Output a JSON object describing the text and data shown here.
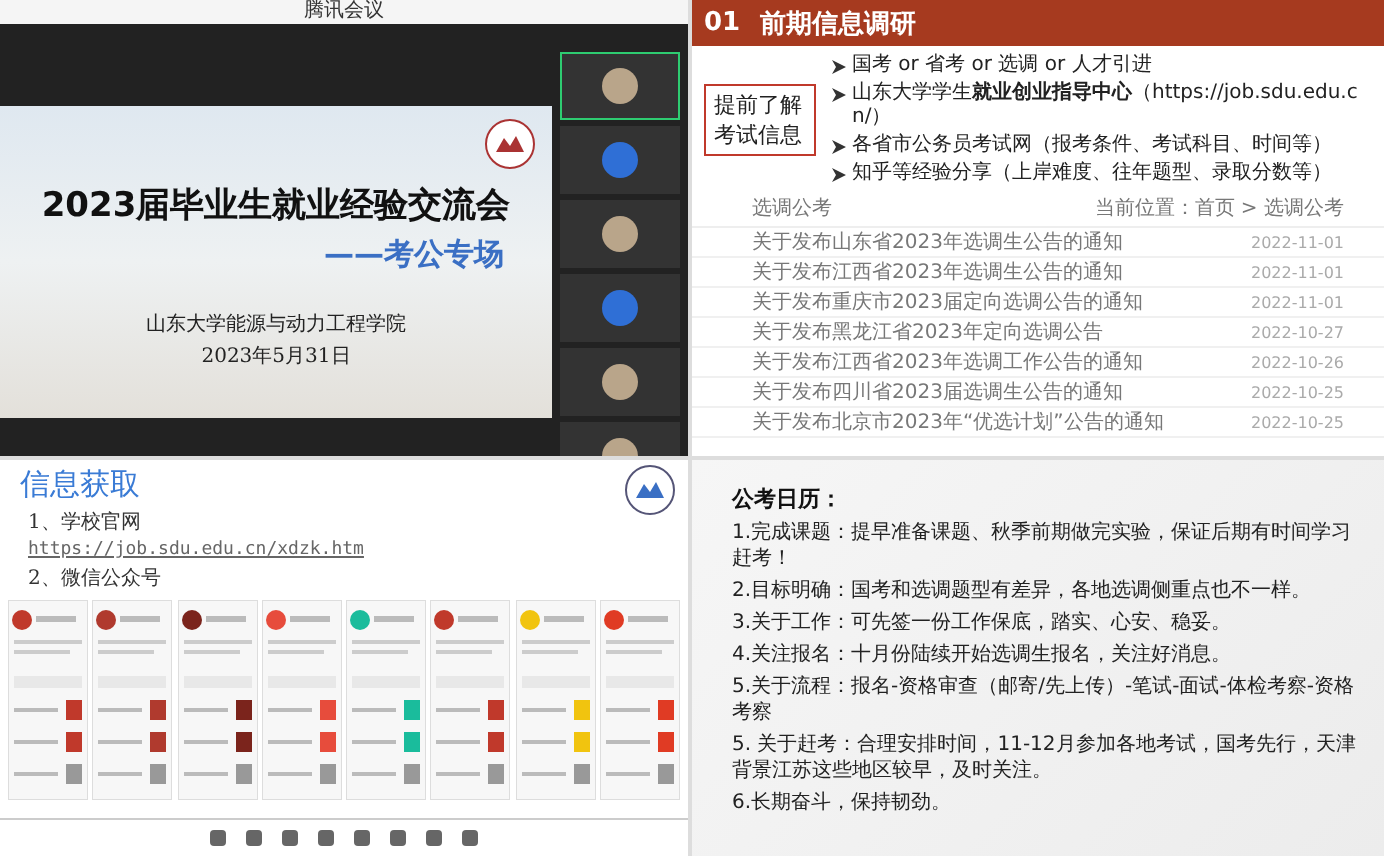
{
  "meeting": {
    "title": "腾讯会议",
    "slide": {
      "title": "2023届毕业生就业经验交流会",
      "subtitle": "——考公专场",
      "school": "山东大学能源与动力工程学院",
      "date": "2023年5月31日"
    },
    "participants": [
      {
        "kind": "photo",
        "speaking": true
      },
      {
        "kind": "initials",
        "speaking": false
      },
      {
        "kind": "photo",
        "speaking": false
      },
      {
        "kind": "initials",
        "speaking": false
      },
      {
        "kind": "photo",
        "speaking": false
      },
      {
        "kind": "photo",
        "speaking": false
      }
    ]
  },
  "research": {
    "number": "01",
    "heading": "前期信息调研",
    "callout": "提前了解考试信息",
    "bullets": [
      "国考 or 省考 or 选调 or 人才引进",
      "山东大学学生**就业创业指导中心**（https://job.sdu.edu.cn/）",
      "各省市公务员考试网（报考条件、考试科目、时间等）",
      "知乎等经验分享（上岸难度、往年题型、录取分数等）"
    ],
    "list_title": "选调公考",
    "breadcrumb": "当前位置：首页 > 选调公考",
    "rows": [
      {
        "title": "关于发布山东省2023年选调生公告的通知",
        "date": "2022-11-01"
      },
      {
        "title": "关于发布江西省2023年选调生公告的通知",
        "date": "2022-11-01"
      },
      {
        "title": "关于发布重庆市2023届定向选调公告的通知",
        "date": "2022-11-01"
      },
      {
        "title": "关于发布黑龙江省2023年定向选调公告",
        "date": "2022-10-27"
      },
      {
        "title": "关于发布江西省2023年选调工作公告的通知",
        "date": "2022-10-26"
      },
      {
        "title": "关于发布四川省2023届选调生公告的通知",
        "date": "2022-10-25"
      },
      {
        "title": "关于发布北京市2023年“优选计划”公告的通知",
        "date": "2022-10-25"
      }
    ]
  },
  "info": {
    "heading": "信息获取",
    "item_1": "1、学校官网",
    "link": "https://job.sdu.edu.cn/xdzk.htm",
    "item_2": "2、微信公众号",
    "wechat_accounts": [
      {
        "color": "#c0392b"
      },
      {
        "color": "#b03a2e"
      },
      {
        "color": "#7b241c"
      },
      {
        "color": "#e74c3c"
      },
      {
        "color": "#1abc9c"
      },
      {
        "color": "#c0392b"
      },
      {
        "color": "#f1c40f"
      },
      {
        "color": "#e03b24"
      }
    ]
  },
  "calendar": {
    "title": "公考日历：",
    "items": [
      "1.完成课题：提早准备课题、秋季前期做完实验，保证后期有时间学习赶考！",
      "2.目标明确：国考和选调题型有差异，各地选调侧重点也不一样。",
      "3.关于工作：可先签一份工作保底，踏实、心安、稳妥。",
      "4.关注报名：十月份陆续开始选调生报名，关注好消息。",
      "5.关于流程：报名-资格审查（邮寄/先上传）-笔试-面试-体检考察-资格考察",
      "5. 关于赶考：合理安排时间，11-12月参加各地考试，国考先行，天津背景江苏这些地区较早，及时关注。",
      "6.长期奋斗，保持韧劲。"
    ]
  }
}
